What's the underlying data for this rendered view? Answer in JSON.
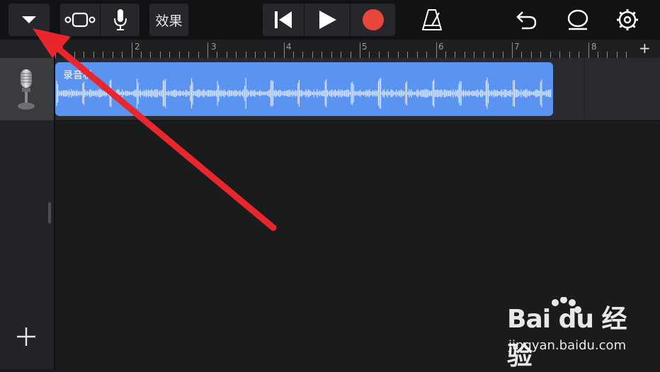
{
  "toolbar": {
    "browser_icon": "triangle-down-icon",
    "tracks_view_icon": "tracks-view-icon",
    "mic_icon": "microphone-icon",
    "effects_label": "效果",
    "transport": {
      "rewind_icon": "skip-back-icon",
      "play_icon": "play-icon",
      "record_icon": "record-icon",
      "record_color": "#e8453c"
    },
    "metronome_icon": "metronome-icon",
    "undo_icon": "undo-icon",
    "loop_icon": "loop-icon",
    "settings_icon": "gear-icon"
  },
  "ruler": {
    "bars": [
      "2",
      "3",
      "4",
      "5",
      "6",
      "7",
      "8"
    ],
    "add_section_label": "+"
  },
  "tracks": [
    {
      "instrument_icon": "microphone-icon",
      "region_label": "录音机"
    }
  ],
  "sidebar": {
    "add_track_label": "+"
  },
  "annotation": {
    "arrow_color": "#e8262b"
  },
  "watermark": {
    "logo": "Bai du 经验",
    "url": "jingyan.baidu.com"
  },
  "colors": {
    "region": "#5b93f0",
    "background": "#1a1b1d"
  }
}
